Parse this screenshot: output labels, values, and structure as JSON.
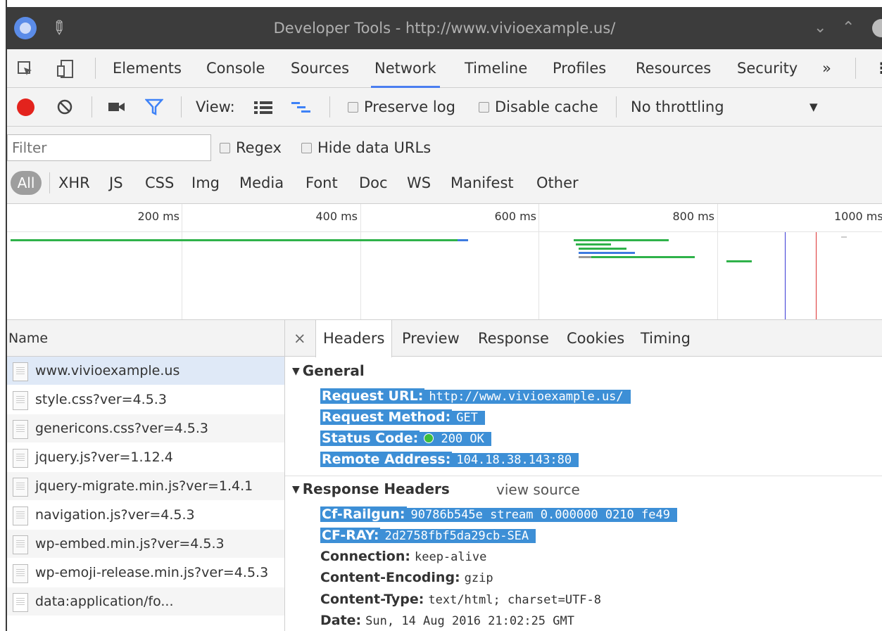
{
  "window": {
    "title": "Developer Tools - http://www.vivioexample.us/",
    "minimize_glyph": "⌄",
    "maximize_glyph": "⌃"
  },
  "panel_tabs": [
    "Elements",
    "Console",
    "Sources",
    "Network",
    "Timeline",
    "Profiles",
    "Resources",
    "Security"
  ],
  "panel_overflow": "»",
  "active_panel": "Network",
  "network_toolbar": {
    "view_label": "View:",
    "preserve_log": "Preserve log",
    "disable_cache": "Disable cache",
    "throttling": "No throttling",
    "record_color": "#e3231d"
  },
  "filter": {
    "placeholder": "Filter",
    "regex": "Regex",
    "hide_data_urls": "Hide data URLs",
    "types": [
      "All",
      "XHR",
      "JS",
      "CSS",
      "Img",
      "Media",
      "Font",
      "Doc",
      "WS",
      "Manifest",
      "Other"
    ],
    "active_type": "All"
  },
  "overview": {
    "ticks": [
      "200 ms",
      "400 ms",
      "600 ms",
      "800 ms",
      "1000 ms"
    ]
  },
  "requests": {
    "header": "Name",
    "items": [
      "www.vivioexample.us",
      "style.css?ver=4.5.3",
      "genericons.css?ver=4.5.3",
      "jquery.js?ver=1.12.4",
      "jquery-migrate.min.js?ver=1.4.1",
      "navigation.js?ver=4.5.3",
      "wp-embed.min.js?ver=4.5.3",
      "wp-emoji-release.min.js?ver=4.5.3",
      "data:application/fo..."
    ],
    "selected_index": 0
  },
  "details": {
    "close_glyph": "×",
    "tabs": [
      "Headers",
      "Preview",
      "Response",
      "Cookies",
      "Timing"
    ],
    "active_tab": "Headers",
    "general": {
      "title": "General",
      "request_url_key": "Request URL:",
      "request_url": "http://www.vivioexample.us/",
      "request_method_key": "Request Method:",
      "request_method": "GET",
      "status_code_key": "Status Code:",
      "status_code": "200 OK",
      "remote_address_key": "Remote Address:",
      "remote_address": "104.18.38.143:80"
    },
    "response_headers": {
      "title": "Response Headers",
      "view_source": "view source",
      "rows": [
        {
          "key": "Cf-Railgun:",
          "value": "90786b545e stream 0.000000 0210 fe49"
        },
        {
          "key": "CF-RAY:",
          "value": "2d2758fbf5da29cb-SEA"
        },
        {
          "key": "Connection:",
          "value": "keep-alive"
        },
        {
          "key": "Content-Encoding:",
          "value": "gzip"
        },
        {
          "key": "Content-Type:",
          "value": "text/html; charset=UTF-8"
        },
        {
          "key": "Date:",
          "value": "Sun, 14 Aug 2016 21:02:25 GMT"
        }
      ]
    }
  },
  "colors": {
    "selection_highlight": "#3d8fd6",
    "accent": "#4a7ef0",
    "status_ok": "#3cbd3c"
  }
}
